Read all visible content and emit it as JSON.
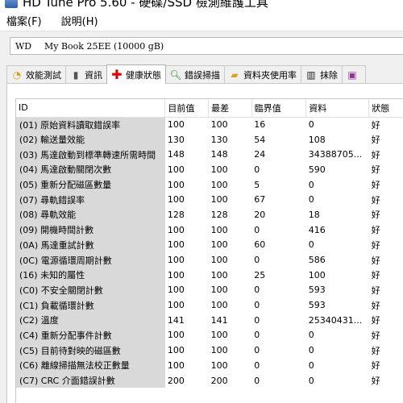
{
  "window": {
    "title": "HD Tune Pro 5.60 - 硬碟/SSD 檢測維護工具"
  },
  "menu": {
    "items": [
      "檔案(F)",
      "說明(H)"
    ]
  },
  "drive": {
    "vendor": "WD",
    "model": "My Book 25EE (10000 gB)"
  },
  "tabs": [
    {
      "label": "效能測試",
      "icon": "speedometer-icon"
    },
    {
      "label": "資訊",
      "icon": "info-icon"
    },
    {
      "label": "健康狀態",
      "icon": "health-cross-icon",
      "active": true
    },
    {
      "label": "錯誤掃描",
      "icon": "magnifier-icon"
    },
    {
      "label": "資料夾使用率",
      "icon": "folder-icon"
    },
    {
      "label": "抹除",
      "icon": "trash-icon"
    },
    {
      "label": "",
      "icon": "extra-tab-icon"
    }
  ],
  "smart": {
    "columns": [
      "ID",
      "目前值",
      "最差",
      "臨界值",
      "資料",
      "狀態"
    ],
    "rows": [
      [
        "(01) 原始資料讀取錯誤率",
        "100",
        "100",
        "16",
        "0",
        "好"
      ],
      [
        "(02) 輸送量效能",
        "130",
        "130",
        "54",
        "108",
        "好"
      ],
      [
        "(03) 馬達啟動到標準轉速所需時間",
        "148",
        "148",
        "24",
        "34388705...",
        "好"
      ],
      [
        "(04) 馬達啟動關閉次數",
        "100",
        "100",
        "0",
        "590",
        "好"
      ],
      [
        "(05) 重新分配磁區數量",
        "100",
        "100",
        "5",
        "0",
        "好"
      ],
      [
        "(07) 尋軌錯誤率",
        "100",
        "100",
        "67",
        "0",
        "好"
      ],
      [
        "(08) 尋軌效能",
        "128",
        "128",
        "20",
        "18",
        "好"
      ],
      [
        "(09) 開機時間計數",
        "100",
        "100",
        "0",
        "416",
        "好"
      ],
      [
        "(0A) 馬達重試計數",
        "100",
        "100",
        "60",
        "0",
        "好"
      ],
      [
        "(0C) 電源循環周期計數",
        "100",
        "100",
        "0",
        "586",
        "好"
      ],
      [
        "(16) 未知的屬性",
        "100",
        "100",
        "25",
        "100",
        "好"
      ],
      [
        "(C0) 不安全關閉計數",
        "100",
        "100",
        "0",
        "593",
        "好"
      ],
      [
        "(C1) 負載循環計數",
        "100",
        "100",
        "0",
        "593",
        "好"
      ],
      [
        "(C2) 溫度",
        "141",
        "141",
        "0",
        "25340431...",
        "好"
      ],
      [
        "(C4) 重新分配事件計數",
        "100",
        "100",
        "0",
        "0",
        "好"
      ],
      [
        "(C5) 目前待對映的磁區數",
        "100",
        "100",
        "0",
        "0",
        "好"
      ],
      [
        "(C6) 離線掃描無法校正數量",
        "100",
        "100",
        "0",
        "0",
        "好"
      ],
      [
        "(C7) CRC 介面錯誤計數",
        "200",
        "200",
        "0",
        "0",
        "好"
      ]
    ]
  }
}
